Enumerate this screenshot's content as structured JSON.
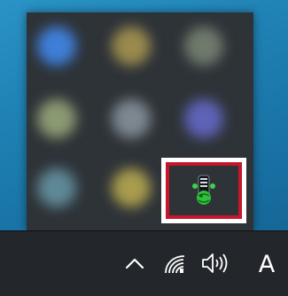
{
  "notification_area": {
    "hidden_icons": [
      {
        "name": "tray-slot-1",
        "color": "#3f7fd9"
      },
      {
        "name": "tray-slot-2",
        "color": "#9a8a4e"
      },
      {
        "name": "tray-slot-3",
        "color": "#6f7a6c"
      },
      {
        "name": "tray-slot-4",
        "color": "#8b9a73"
      },
      {
        "name": "tray-slot-5",
        "color": "#7e8891"
      },
      {
        "name": "tray-slot-6",
        "color": "#5f63b8"
      },
      {
        "name": "tray-slot-7",
        "color": "#5f8896"
      },
      {
        "name": "tray-slot-8",
        "color": "#a99c4e"
      }
    ],
    "highlighted_icon": {
      "icon": "green-device-app-icon",
      "highlight_color": "#c4172c"
    }
  },
  "taskbar": {
    "show_hidden_icons": {
      "icon": "chevron-up-icon"
    },
    "network": {
      "icon": "network-wifi-icon"
    },
    "volume": {
      "icon": "volume-icon"
    },
    "input_indicator": {
      "label": "A"
    }
  }
}
